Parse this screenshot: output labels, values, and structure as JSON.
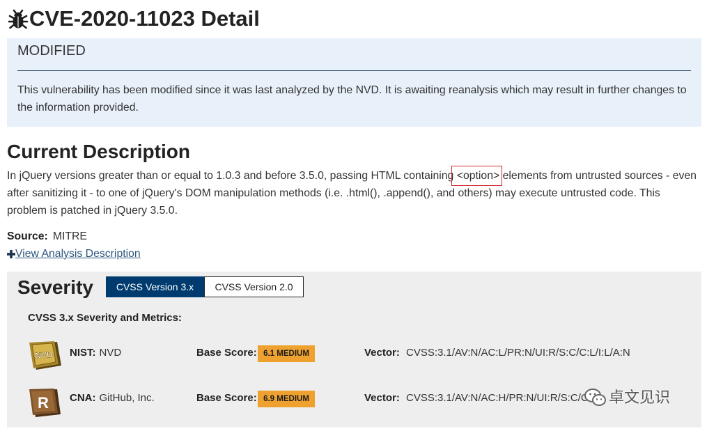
{
  "page": {
    "title": "CVE-2020-11023 Detail",
    "title_icon": "bug-icon"
  },
  "status_alert": {
    "heading": "MODIFIED",
    "message": "This vulnerability has been modified since it was last analyzed by the NVD. It is awaiting reanalysis which may result in further changes to the information provided."
  },
  "description": {
    "heading": "Current Description",
    "text_before": "In jQuery versions greater than or equal to 1.0.3 and before 3.5.0, passing HTML containing ",
    "highlight": "<option>",
    "text_after": " elements from untrusted sources - even after sanitizing it - to one of jQuery's DOM manipulation methods (i.e. .html(), .append(), and others) may execute untrusted code. This problem is patched in jQuery 3.5.0.",
    "source_label": "Source:",
    "source_value": "MITRE",
    "analysis_link_icon": "plus-icon",
    "analysis_link": "View Analysis Description"
  },
  "severity": {
    "heading": "Severity",
    "tabs": [
      {
        "label": "CVSS Version 3.x",
        "active": true
      },
      {
        "label": "CVSS Version 2.0",
        "active": false
      }
    ],
    "subheading": "CVSS 3.x Severity and Metrics:",
    "base_score_label": "Base Score:",
    "vector_label": "Vector:",
    "rows": [
      {
        "icon": "nvd-logo",
        "logo_text": "NVD",
        "source_label": "NIST:",
        "source_value": "NVD",
        "score": "6.1 MEDIUM",
        "vector": "CVSS:3.1/AV:N/AC:L/PR:N/UI:R/S:C/C:L/I:L/A:N"
      },
      {
        "icon": "cna-logo",
        "logo_text": "R",
        "source_label": "CNA:",
        "source_value": "GitHub, Inc.",
        "score": "6.9 MEDIUM",
        "vector": "CVSS:3.1/AV:N/AC:H/PR:N/UI:R/S:C/C"
      }
    ]
  },
  "watermark": {
    "icon": "wechat-icon",
    "text": "卓文见识"
  },
  "colors": {
    "tab_active": "#003b6f",
    "severity_medium": "#eea12e",
    "alert_background": "#e8f1fa",
    "annotation_box": "#d0282e",
    "link": "#2c567e"
  }
}
